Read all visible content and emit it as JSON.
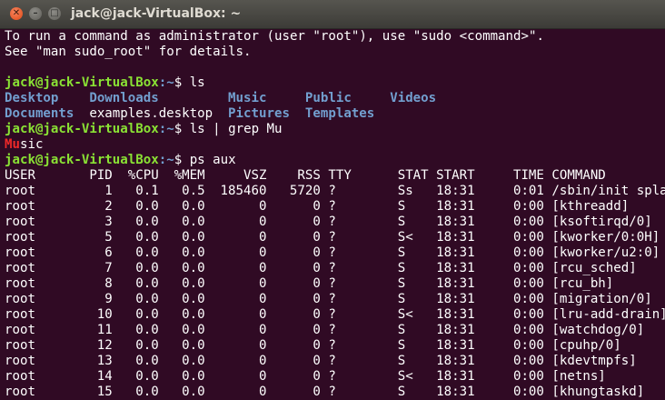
{
  "window": {
    "title": "jack@jack-VirtualBox: ~",
    "controls": [
      "close-icon",
      "minimize-icon",
      "maximize-icon"
    ]
  },
  "colors": {
    "background": "#300a24",
    "prompt_user": "#8ae234",
    "prompt_path": "#729fcf",
    "directory": "#729fcf",
    "grep_match": "#ef2929",
    "text": "#ffffff"
  },
  "terminal": {
    "motd": [
      "To run a command as administrator (user \"root\"), use \"sudo <command>\".",
      "See \"man sudo_root\" for details."
    ],
    "prompt_user": "jack@jack-VirtualBox",
    "prompt_path": ":~",
    "prompt_symbol": "$",
    "commands": [
      "ls",
      "ls | grep Mu",
      "ps aux"
    ],
    "ls_output": [
      [
        {
          "text": "Desktop",
          "type": "dir"
        },
        {
          "text": "Downloads",
          "type": "dir"
        },
        {
          "text": "Music",
          "type": "dir"
        },
        {
          "text": "Public",
          "type": "dir"
        },
        {
          "text": "Videos",
          "type": "dir"
        }
      ],
      [
        {
          "text": "Documents",
          "type": "dir"
        },
        {
          "text": "examples.desktop",
          "type": "file"
        },
        {
          "text": "Pictures",
          "type": "dir"
        },
        {
          "text": "Templates",
          "type": "dir"
        }
      ]
    ],
    "grep_output": {
      "match": "Mu",
      "rest": "sic"
    },
    "ps_header": [
      "USER",
      "PID",
      "%CPU",
      "%MEM",
      "VSZ",
      "RSS",
      "TTY",
      "STAT",
      "START",
      "TIME",
      "COMMAND"
    ],
    "ps_rows": [
      [
        "root",
        "1",
        "0.1",
        "0.5",
        "185460",
        "5720",
        "?",
        "Ss",
        "18:31",
        "0:01",
        "/sbin/init spla"
      ],
      [
        "root",
        "2",
        "0.0",
        "0.0",
        "0",
        "0",
        "?",
        "S",
        "18:31",
        "0:00",
        "[kthreadd]"
      ],
      [
        "root",
        "3",
        "0.0",
        "0.0",
        "0",
        "0",
        "?",
        "S",
        "18:31",
        "0:00",
        "[ksoftirqd/0]"
      ],
      [
        "root",
        "5",
        "0.0",
        "0.0",
        "0",
        "0",
        "?",
        "S<",
        "18:31",
        "0:00",
        "[kworker/0:0H]"
      ],
      [
        "root",
        "6",
        "0.0",
        "0.0",
        "0",
        "0",
        "?",
        "S",
        "18:31",
        "0:00",
        "[kworker/u2:0]"
      ],
      [
        "root",
        "7",
        "0.0",
        "0.0",
        "0",
        "0",
        "?",
        "S",
        "18:31",
        "0:00",
        "[rcu_sched]"
      ],
      [
        "root",
        "8",
        "0.0",
        "0.0",
        "0",
        "0",
        "?",
        "S",
        "18:31",
        "0:00",
        "[rcu_bh]"
      ],
      [
        "root",
        "9",
        "0.0",
        "0.0",
        "0",
        "0",
        "?",
        "S",
        "18:31",
        "0:00",
        "[migration/0]"
      ],
      [
        "root",
        "10",
        "0.0",
        "0.0",
        "0",
        "0",
        "?",
        "S<",
        "18:31",
        "0:00",
        "[lru-add-drain]"
      ],
      [
        "root",
        "11",
        "0.0",
        "0.0",
        "0",
        "0",
        "?",
        "S",
        "18:31",
        "0:00",
        "[watchdog/0]"
      ],
      [
        "root",
        "12",
        "0.0",
        "0.0",
        "0",
        "0",
        "?",
        "S",
        "18:31",
        "0:00",
        "[cpuhp/0]"
      ],
      [
        "root",
        "13",
        "0.0",
        "0.0",
        "0",
        "0",
        "?",
        "S",
        "18:31",
        "0:00",
        "[kdevtmpfs]"
      ],
      [
        "root",
        "14",
        "0.0",
        "0.0",
        "0",
        "0",
        "?",
        "S<",
        "18:31",
        "0:00",
        "[netns]"
      ],
      [
        "root",
        "15",
        "0.0",
        "0.0",
        "0",
        "0",
        "?",
        "S",
        "18:31",
        "0:00",
        "[khungtaskd]"
      ]
    ]
  }
}
